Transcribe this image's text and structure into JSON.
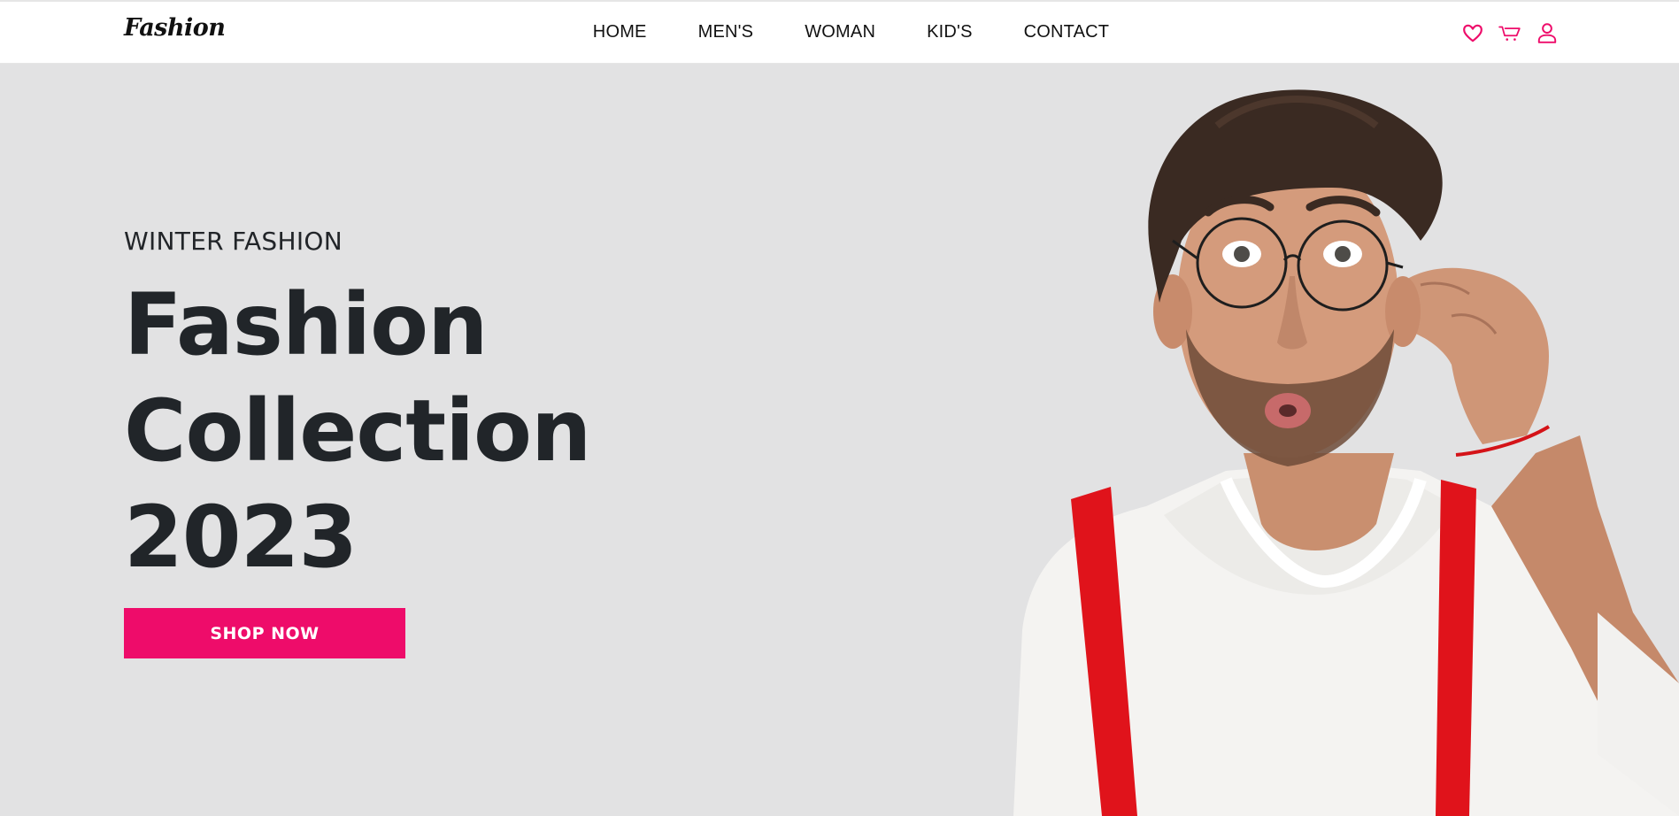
{
  "brand": {
    "name": "Fashion"
  },
  "nav": {
    "links": [
      "HOME",
      "MEN'S",
      "WOMAN",
      "KID'S",
      "CONTACT"
    ],
    "icons": [
      "heart-icon",
      "cart-icon",
      "user-icon"
    ],
    "accent_color": "#ee0c6a"
  },
  "hero": {
    "eyebrow": "WINTER FASHION",
    "title_lines": [
      "Fashion",
      "Collection",
      "2023"
    ],
    "cta_label": "SHOP NOW",
    "cta_color": "#ee0c6a",
    "background_color": "#e2e2e3",
    "image": "man-with-glasses-red-suspenders"
  }
}
